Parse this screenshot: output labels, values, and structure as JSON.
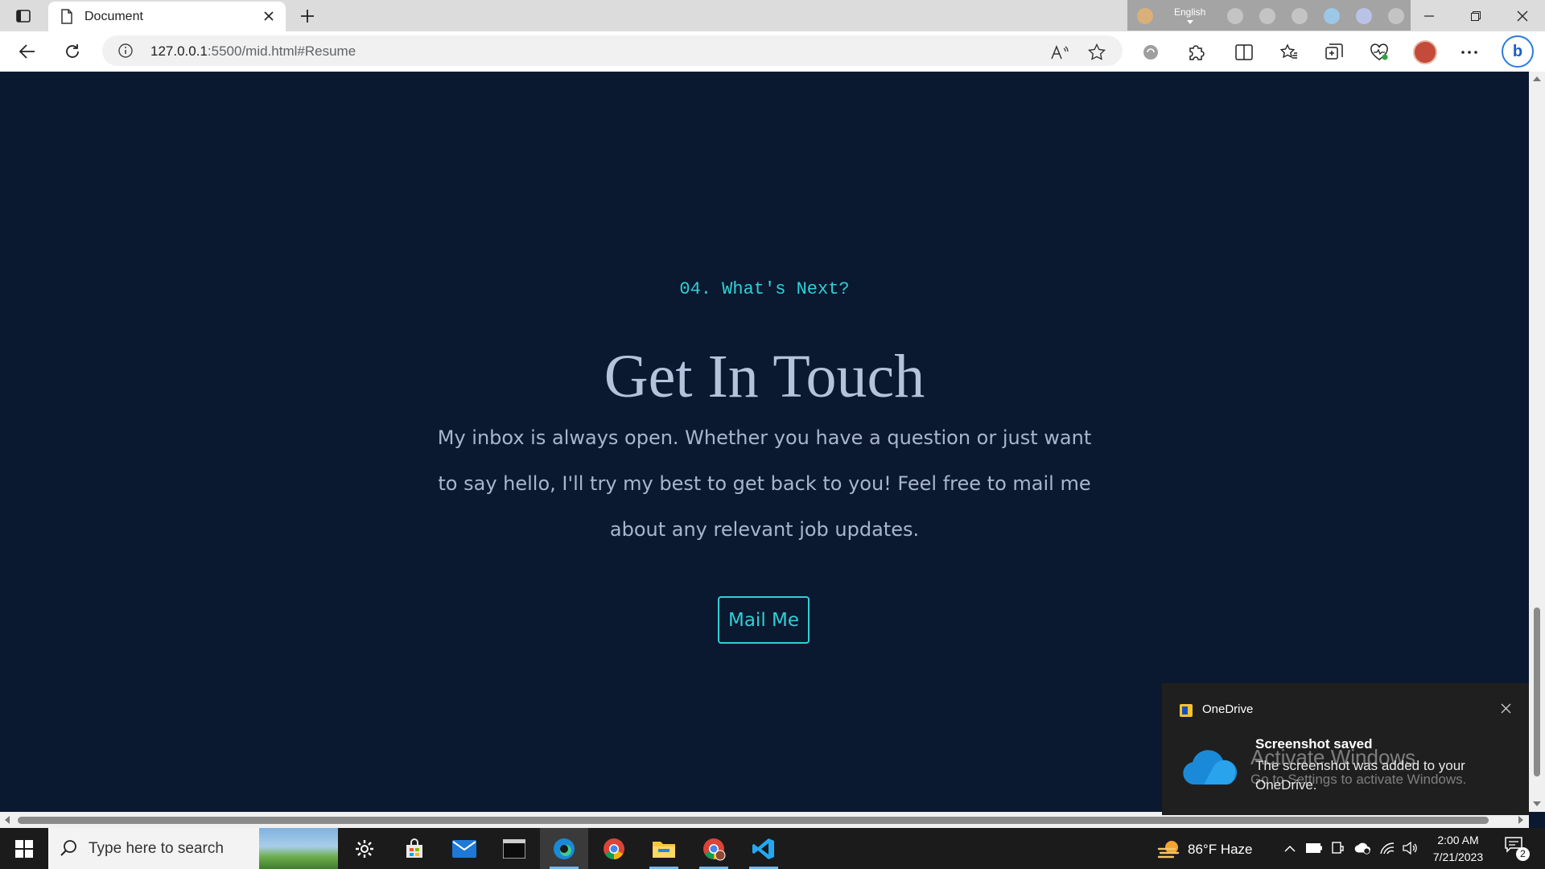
{
  "browser": {
    "tab_title": "Document",
    "url_host": "127.0.0.1",
    "url_rest": ":5500/mid.html#Resume",
    "language_bar": "English"
  },
  "page": {
    "eyebrow": "04. What's Next?",
    "heading": "Get In Touch",
    "body": "My inbox is always open. Whether you have a question or just want to say hello, I'll try my best to get back to you! Feel free to mail me about any relevant job updates.",
    "button_label": "Mail Me",
    "colors": {
      "background": "#0a192f",
      "accent": "#2fd0d6",
      "text": "#a8b5cf",
      "heading": "#b5c2db"
    }
  },
  "toast": {
    "app_name": "OneDrive",
    "title": "Screenshot saved",
    "body": "The screenshot was added to your OneDrive."
  },
  "watermark": {
    "line1": "Activate Windows",
    "line2": "Go to Settings to activate Windows."
  },
  "taskbar": {
    "search_placeholder": "Type here to search",
    "weather": "86°F  Haze",
    "time": "2:00 AM",
    "date": "7/21/2023",
    "notification_count": "2",
    "apps": [
      "gear-icon",
      "store-icon",
      "mail-icon",
      "terminal-icon",
      "edge-icon",
      "chrome-icon",
      "file-explorer-icon",
      "chrome-profile-icon",
      "vscode-icon"
    ]
  }
}
